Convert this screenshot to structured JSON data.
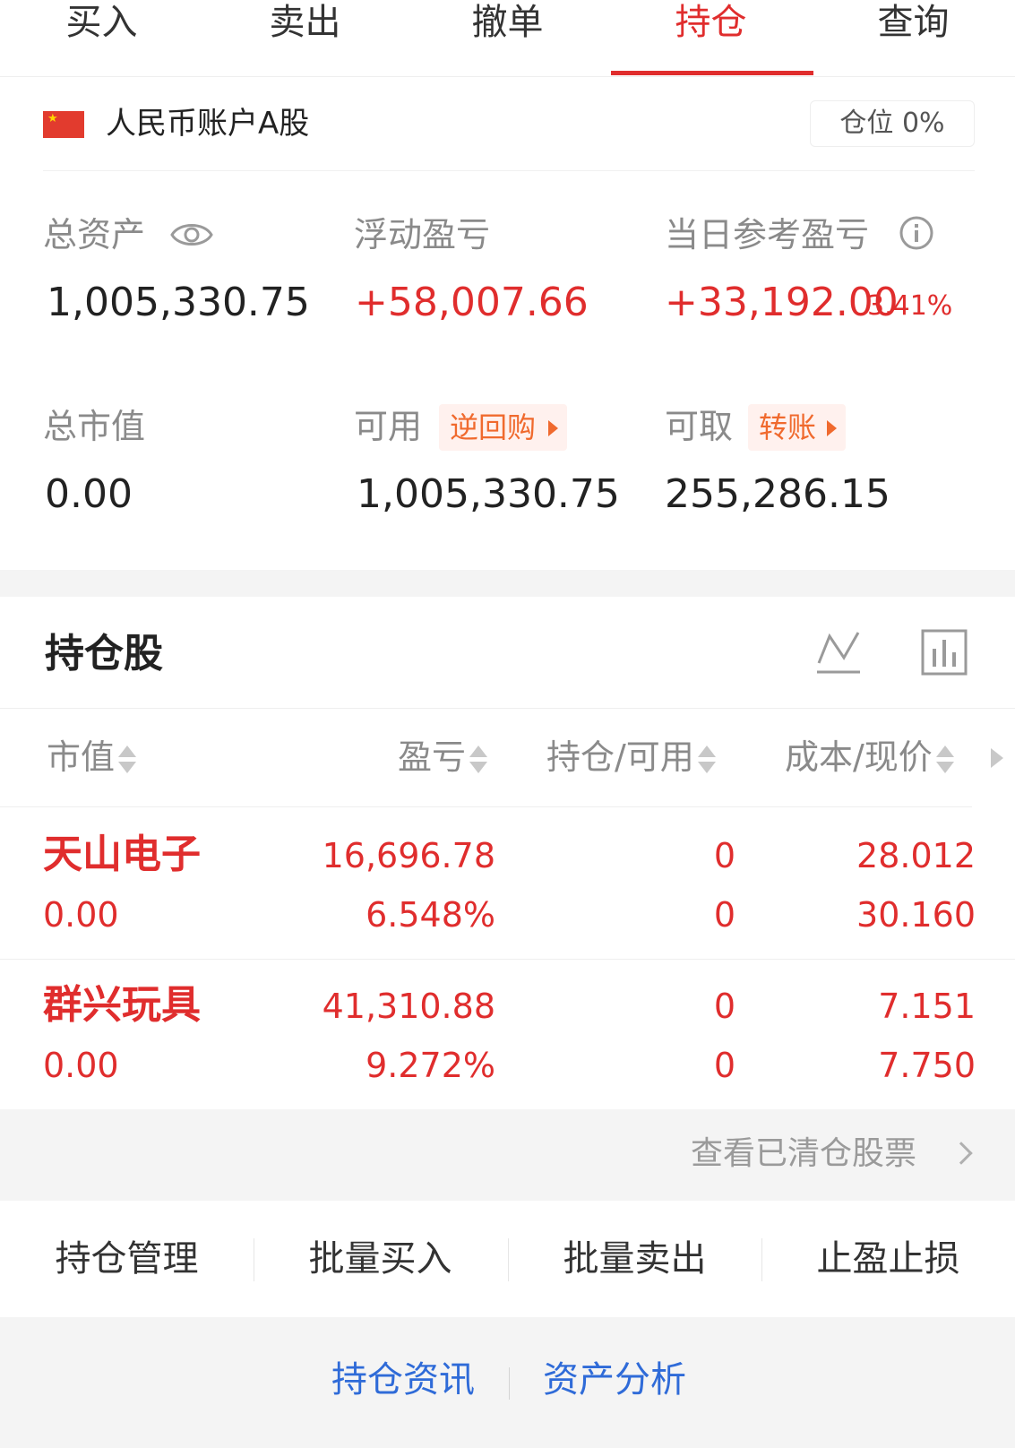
{
  "tabs": [
    {
      "label": "买入"
    },
    {
      "label": "卖出"
    },
    {
      "label": "撤单"
    },
    {
      "label": "持仓",
      "active": true
    },
    {
      "label": "查询"
    }
  ],
  "account": {
    "name": "人民币账户A股",
    "position_badge": "仓位 0%"
  },
  "summary": {
    "total_assets_label": "总资产",
    "total_assets_value": "1,005,330.75",
    "floating_pl_label": "浮动盈亏",
    "floating_pl_value": "+58,007.66",
    "daily_pl_label": "当日参考盈亏",
    "daily_pl_value": "+33,192.00",
    "daily_pl_pct": "3.41%",
    "market_value_label": "总市值",
    "market_value_value": "0.00",
    "available_label": "可用",
    "available_tag": "逆回购",
    "available_value": "1,005,330.75",
    "withdrawable_label": "可取",
    "withdrawable_tag": "转账",
    "withdrawable_value": "255,286.15"
  },
  "holdings": {
    "title": "持仓股",
    "columns": [
      "市值",
      "盈亏",
      "持仓/可用",
      "成本/现价"
    ],
    "rows": [
      {
        "name": "天山电子",
        "market_value": "0.00",
        "pl": "16,696.78",
        "pl_pct": "6.548%",
        "hold": "0",
        "avail": "0",
        "cost": "28.012",
        "price": "30.160"
      },
      {
        "name": "群兴玩具",
        "market_value": "0.00",
        "pl": "41,310.88",
        "pl_pct": "9.272%",
        "hold": "0",
        "avail": "0",
        "cost": "7.151",
        "price": "7.750"
      }
    ],
    "cleared_link": "查看已清仓股票"
  },
  "actions": [
    "持仓管理",
    "批量买入",
    "批量卖出",
    "止盈止损"
  ],
  "footer_links": [
    "持仓资讯",
    "资产分析"
  ],
  "colors": {
    "accent_red": "#e02d2d",
    "tag_orange": "#f06a2e",
    "link_blue": "#2f6bd8"
  }
}
